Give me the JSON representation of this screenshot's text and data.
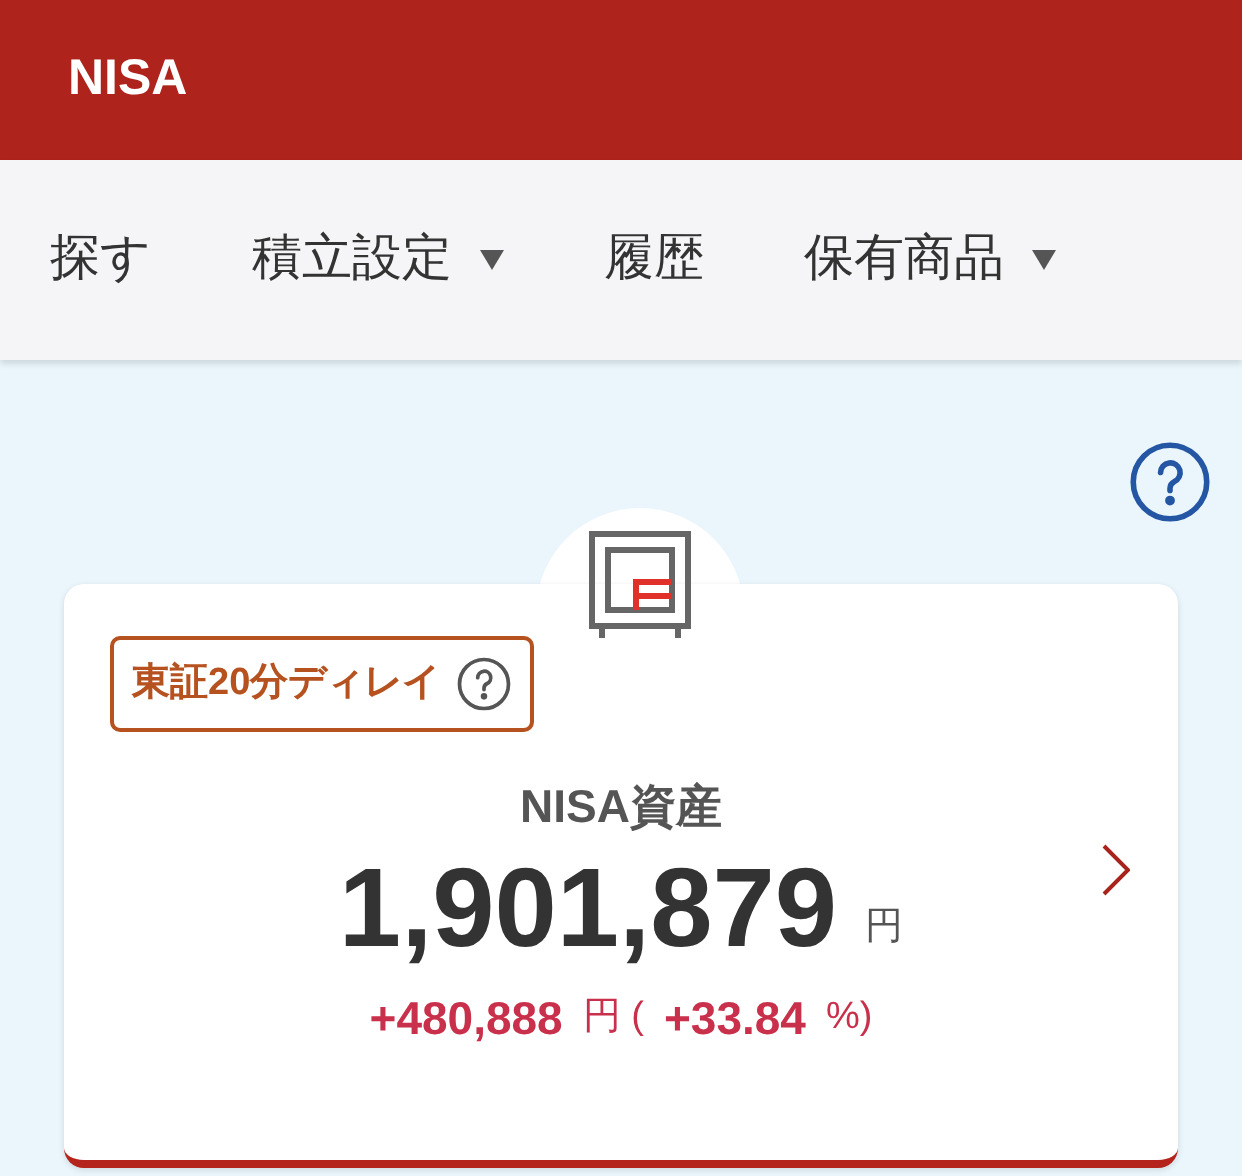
{
  "header": {
    "title": "NISA"
  },
  "nav": [
    {
      "label": "探す",
      "dropdown": false
    },
    {
      "label": "積立設定",
      "dropdown": true
    },
    {
      "label": "履歴",
      "dropdown": false
    },
    {
      "label": "保有商品",
      "dropdown": true
    }
  ],
  "card": {
    "delay_badge": "東証20分ディレイ",
    "label": "NISA資産",
    "amount": "1,901,879",
    "amount_unit": "円",
    "change": {
      "amount": "+480,888",
      "unit": "円 (",
      "percent": "+33.84",
      "percent_unit": "%)"
    }
  }
}
